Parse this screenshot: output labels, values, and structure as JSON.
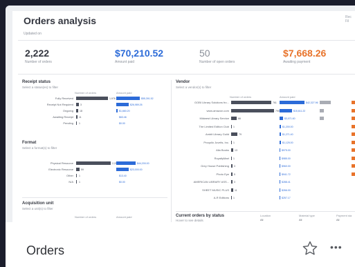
{
  "footer": {
    "title": "Orders"
  },
  "dashboard": {
    "title": "Orders analysis",
    "updated_label": "Updated on",
    "corner_text": "Rec Fil",
    "kpis": [
      {
        "value": "2,222",
        "label": "Number of orders",
        "color": "#33363f"
      },
      {
        "value": "$70,210.52",
        "label": "Amount paid",
        "color": "#2c6bd8"
      },
      {
        "value": "50",
        "label": "Number of open orders",
        "color": "#8a8f99"
      },
      {
        "value": "$7,668.26",
        "label": "Awaiting payment",
        "color": "#e8732a"
      }
    ],
    "receipt_status": {
      "title": "Receipt status",
      "subtitle": "Select a status(es) to filter",
      "col_orders": "Number of orders",
      "col_amount": "Amount paid",
      "rows": [
        {
          "label": "Fully Received",
          "orders": "1,976",
          "amount": "$55,391.52"
        },
        {
          "label": "Receipt Not Required",
          "orders": "3",
          "amount": "$26,989.26"
        },
        {
          "label": "Ongoing",
          "orders": "18",
          "amount": "$1,660.20"
        },
        {
          "label": "Awaiting Receipt",
          "orders": "11",
          "amount": "$63.46"
        },
        {
          "label": "Pending",
          "orders": "1",
          "amount": "$0.00"
        }
      ]
    },
    "format": {
      "title": "Format",
      "subtitle": "Select a format(s) to filter",
      "rows": [
        {
          "label": "Physical Resource",
          "orders": "2,211",
          "amount": "$44,200.00"
        },
        {
          "label": "Electronic Resource",
          "orders": "59",
          "amount": "$23,000.00"
        },
        {
          "label": "Other",
          "orders": "1",
          "amount": "$13.40"
        },
        {
          "label": "N/A",
          "orders": "1",
          "amount": "$0.00"
        }
      ]
    },
    "acquisition_unit": {
      "title": "Acquisition unit",
      "subtitle": "Select a unit(s) to filter",
      "col_orders": "Number of orders",
      "col_amount": "Amount paid"
    },
    "vendor": {
      "title": "Vendor",
      "subtitle": "Select a vendor(s) to filter",
      "col_orders": "Number of orders",
      "col_amount": "Amount paid",
      "rows": [
        {
          "label": "GOBI Library Solutions fro...",
          "orders": "761",
          "amount": "$42,327.96"
        },
        {
          "label": "www.amazon.com",
          "orders": "790",
          "amount": "$15,611.22"
        },
        {
          "label": "Midwest Library Service",
          "orders": "66",
          "amount": "$3,071.60"
        },
        {
          "label": "The Limited Edition Club",
          "orders": "1",
          "amount": "$1,200.00"
        },
        {
          "label": "Ambit Library Guild",
          "orders": "79",
          "amount": "$1,271.40"
        },
        {
          "label": "Proquilo Juvelis, Inc.",
          "orders": "1",
          "amount": "$1,125.00"
        },
        {
          "label": "Alia Books",
          "orders": "13",
          "amount": "$975.00"
        },
        {
          "label": "RoyaltyMart",
          "orders": "1",
          "amount": "$985.00"
        },
        {
          "label": "Grey House Publishing",
          "orders": "3",
          "amount": "$960.00"
        },
        {
          "label": "Photo Eye",
          "orders": "5",
          "amount": "$941.72"
        },
        {
          "label": "AMERICAN LIBRARY ASS...",
          "orders": "3",
          "amount": "$288.41"
        },
        {
          "label": "SHEET MUSIC PLUS",
          "orders": "11",
          "amount": "$266.00"
        },
        {
          "label": "A-R Editions",
          "orders": "1",
          "amount": "$257.17"
        }
      ]
    },
    "current_orders": {
      "title": "Current orders by status",
      "subtitle": "Hover to see details",
      "col1": "Location",
      "col1_val": "All",
      "col2": "Material type",
      "col2_val": "All",
      "col3": "Payment sta",
      "col3_val": "All"
    }
  },
  "colors": {
    "accent_blue": "#2c6bd8",
    "accent_orange": "#e8732a",
    "bar_dark": "#4a4f5c",
    "page_bg": "#1b1d2c"
  },
  "icons": {
    "favorite": "star-outline-icon",
    "more": "more-horizontal-icon"
  }
}
